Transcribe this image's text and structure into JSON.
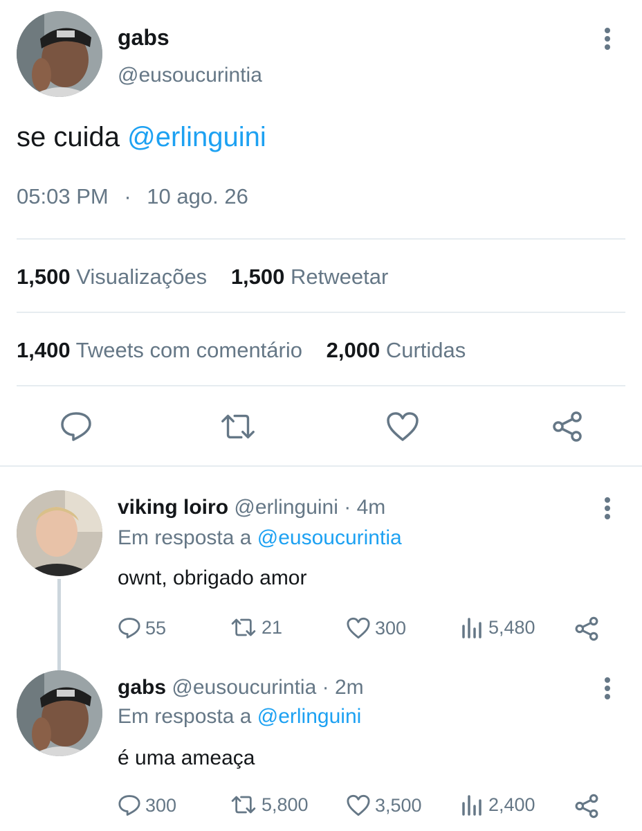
{
  "main_tweet": {
    "author_name": "gabs",
    "author_handle": "@eusoucurintia",
    "text_prefix": "se cuida ",
    "text_mention": "@erlinguini",
    "time": "05:03 PM",
    "separator": "·",
    "date": "10 ago. 26",
    "stats": {
      "views_count": "1,500",
      "views_label": "Visualizações",
      "retweets_count": "1,500",
      "retweets_label": "Retweetar",
      "quotes_count": "1,400",
      "quotes_label": "Tweets com comentário",
      "likes_count": "2,000",
      "likes_label": "Curtidas"
    },
    "actions": [
      "reply-icon",
      "retweet-icon",
      "like-icon",
      "share-icon"
    ]
  },
  "replies": [
    {
      "author_name": "viking loiro",
      "author_handle": "@erlinguini",
      "age": "· 4m",
      "reply_prefix": "Em resposta a ",
      "reply_to": "@eusoucurintia",
      "text": "ownt, obrigado amor",
      "reply_count": "55",
      "retweet_count": "21",
      "like_count": "300",
      "view_count": "5,480"
    },
    {
      "author_name": "gabs",
      "author_handle": "@eusoucurintia",
      "age": "· 2m",
      "reply_prefix": "Em resposta a ",
      "reply_to": "@erlinguini",
      "text": "é uma ameaça",
      "reply_count": "300",
      "retweet_count": "5,800",
      "like_count": "3,500",
      "view_count": "2,400"
    }
  ],
  "colors": {
    "accent": "#1da1f2",
    "muted": "#657786",
    "text": "#14171a",
    "divider": "#e6ecf0"
  }
}
